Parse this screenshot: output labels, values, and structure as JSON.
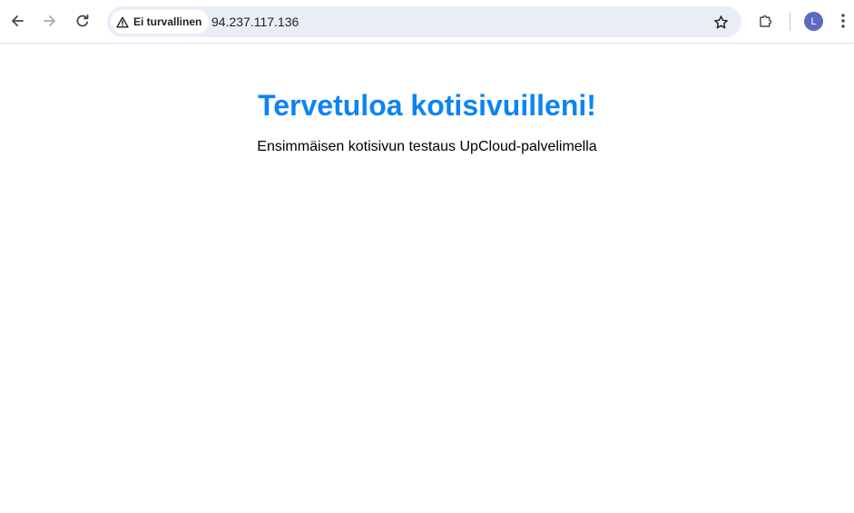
{
  "browser": {
    "nav": {
      "back_icon": "arrow-left-icon",
      "forward_icon": "arrow-right-icon",
      "reload_icon": "reload-icon"
    },
    "omnibox": {
      "security_label": "Ei turvallinen",
      "security_icon": "warning-triangle-icon",
      "url": "94.237.117.136",
      "bookmark_icon": "star-outline-icon"
    },
    "extensions_icon": "puzzle-piece-icon",
    "profile_initial": "L",
    "profile_color": "#5c6bc0",
    "menu_icon": "vertical-dots-icon"
  },
  "page": {
    "title": "Tervetuloa kotisivuilleni!",
    "subtitle": "Ensimmäisen kotisivun testaus UpCloud-palvelimella",
    "title_color": "#0d84f3"
  }
}
